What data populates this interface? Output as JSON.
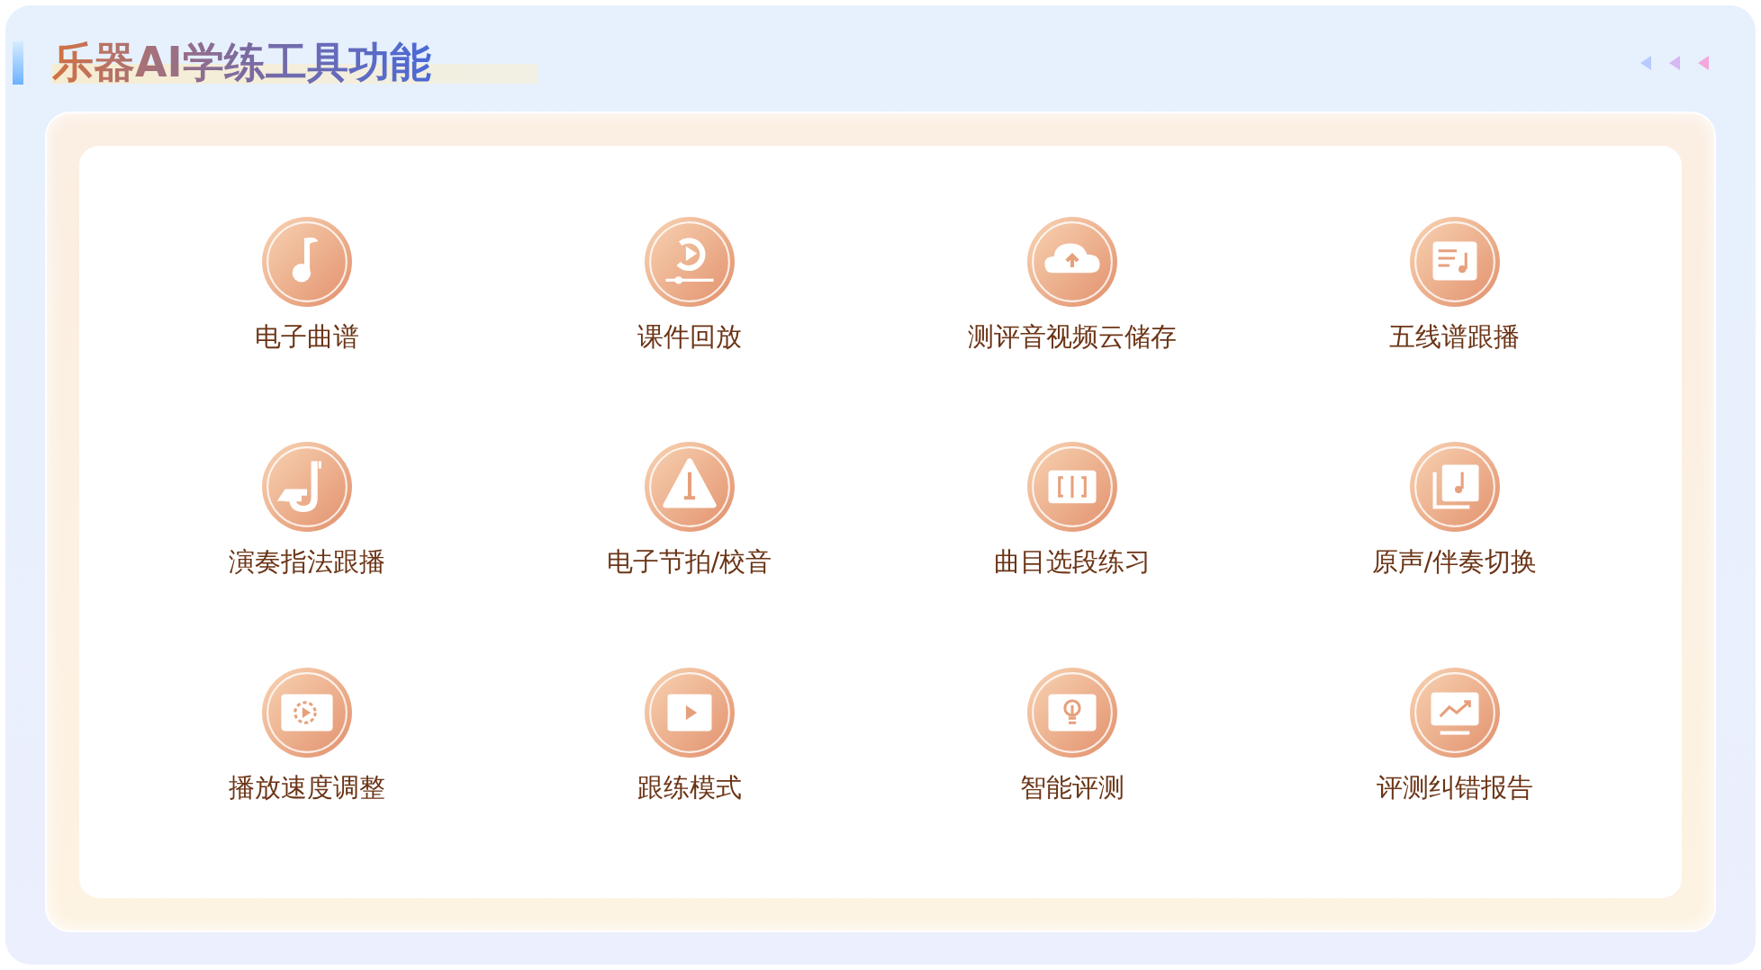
{
  "title": "乐器AI学练工具功能",
  "features": [
    {
      "label": "电子曲谱",
      "kind": "note"
    },
    {
      "label": "课件回放",
      "kind": "replay"
    },
    {
      "label": "测评音视频云储存",
      "kind": "cloud"
    },
    {
      "label": "五线谱跟播",
      "kind": "sheet"
    },
    {
      "label": "演奏指法跟播",
      "kind": "sax"
    },
    {
      "label": "电子节拍/校音",
      "kind": "metronome"
    },
    {
      "label": "曲目选段练习",
      "kind": "segment"
    },
    {
      "label": "原声/伴奏切换",
      "kind": "album"
    },
    {
      "label": "播放速度调整",
      "kind": "speed"
    },
    {
      "label": "跟练模式",
      "kind": "play"
    },
    {
      "label": "智能评测",
      "kind": "bulb"
    },
    {
      "label": "评测纠错报告",
      "kind": "chart"
    }
  ]
}
